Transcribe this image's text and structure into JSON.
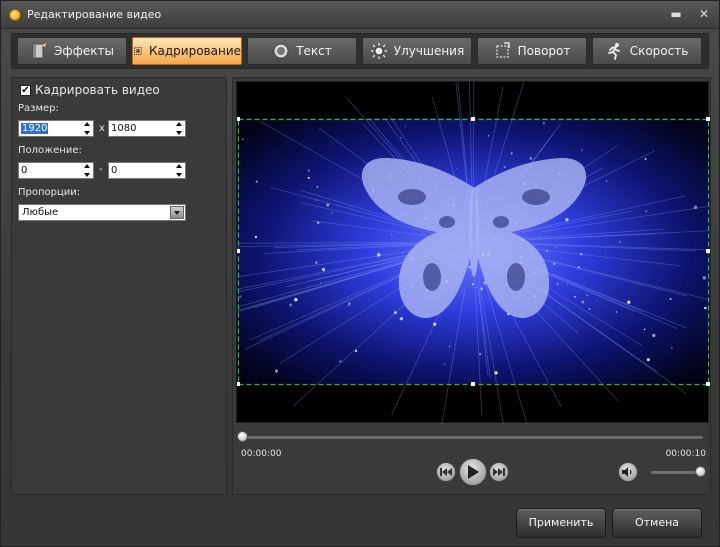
{
  "window": {
    "title": "Редактирование видео",
    "controls": {
      "minimize": "▬",
      "close": "✕"
    }
  },
  "tabs": [
    {
      "label": "Эффекты",
      "icon": "effects-icon"
    },
    {
      "label": "Кадрирование",
      "icon": "crop-icon",
      "active": true
    },
    {
      "label": "Текст",
      "icon": "text-icon"
    },
    {
      "label": "Улучшения",
      "icon": "sun-icon"
    },
    {
      "label": "Поворот",
      "icon": "rotate-icon"
    },
    {
      "label": "Скорость",
      "icon": "runner-icon"
    }
  ],
  "crop": {
    "checkbox_label": "Кадрировать видео",
    "checkbox_checked": true,
    "checkbox_mark": "✔",
    "size_label": "Размер:",
    "width": "1920",
    "size_separator": "x",
    "height": "1080",
    "position_label": "Положение:",
    "pos_x": "0",
    "position_separator": "-",
    "pos_y": "0",
    "aspect_label": "Пропорции:",
    "aspect_value": "Любые"
  },
  "player": {
    "time_start": "00:00:00",
    "time_end": "00:00:10",
    "progress": 0.0,
    "volume": 1.0
  },
  "footer": {
    "apply_label": "Применить",
    "cancel_label": "Отмена"
  },
  "colors": {
    "accent_active_tab": "#f5a64a",
    "crop_border": "#2bbf2b",
    "video_glow": "#3344ff"
  }
}
